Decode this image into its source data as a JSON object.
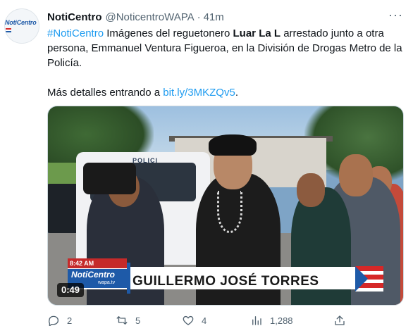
{
  "account": {
    "avatar_logo": "NotiCentro",
    "name": "NotiCentro",
    "handle": "@NoticentroWAPA",
    "separator": "·",
    "time": "41m"
  },
  "tweet": {
    "hashtag": "#NotiCentro",
    "text_before_bold": " Imágenes del reguetonero ",
    "bold_name": "Luar La L",
    "text_after_bold": " arrestado junto a otra persona, Emmanuel Ventura Figueroa, en la División de Drogas Metro de la Policía.",
    "details_prefix": "Más detalles entrando a ",
    "link": "bit.ly/3MKZQv5",
    "details_suffix": "."
  },
  "media": {
    "vehicle_label": "POLICI",
    "time_tag": "8:42 AM",
    "channel_logo": "NotiCentro",
    "channel_sub": "wapa.tv",
    "lower_third_name": "GUILLERMO JOSÉ TORRES",
    "duration": "0:49"
  },
  "actions": {
    "reply_count": "2",
    "retweet_count": "5",
    "like_count": "4",
    "views_count": "1,288"
  },
  "colors": {
    "link": "#1d9bf0",
    "secondary_text": "#536471",
    "primary_text": "#0f1419"
  }
}
